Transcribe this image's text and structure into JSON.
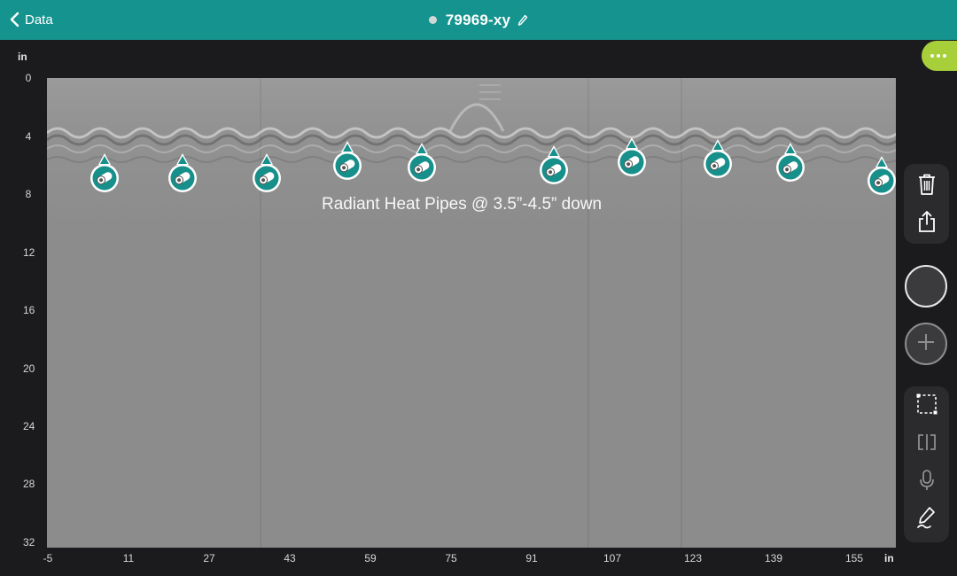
{
  "header": {
    "back_label": "Data",
    "title": "79969-xy"
  },
  "axis": {
    "y_unit": "in",
    "x_unit": "in",
    "y_ticks": [
      "0",
      "4",
      "8",
      "12",
      "16",
      "20",
      "24",
      "28",
      "32"
    ],
    "x_ticks": [
      "-5",
      "11",
      "27",
      "43",
      "59",
      "75",
      "91",
      "107",
      "123",
      "139",
      "155"
    ]
  },
  "scan": {
    "annotation": "Radiant Heat Pipes @ 3.5”-4.5” down",
    "marker_count": 10,
    "marker_color": "#178f8a"
  },
  "colors": {
    "header_bg": "#15948f",
    "accent": "#a6cf3a",
    "background": "#1b1b1d"
  },
  "icons": {
    "back": "chevron-left-icon",
    "edit": "pencil-icon",
    "more": "more-dots-icon",
    "delete": "trash-icon",
    "share": "share-icon",
    "add": "plus-icon",
    "select": "selection-box-icon",
    "split": "split-view-icon",
    "mic": "microphone-icon",
    "annotate": "pen-icon"
  }
}
